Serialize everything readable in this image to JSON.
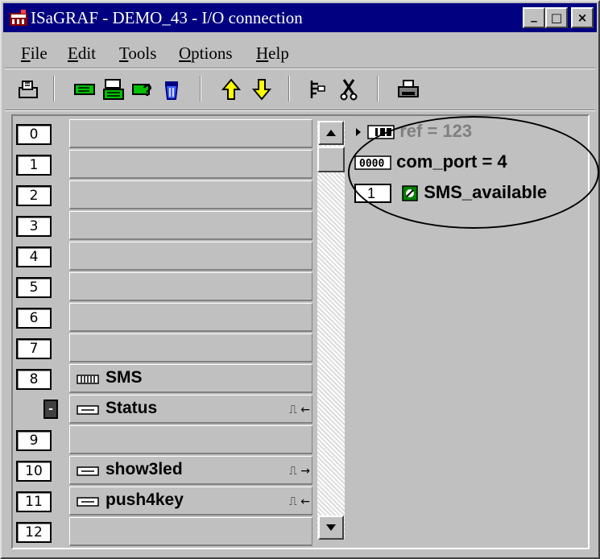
{
  "window": {
    "title": "ISaGRAF - DEMO_43 - I/O connection",
    "controls": {
      "minimize": "_",
      "maximize": "□",
      "close": "×"
    }
  },
  "menu": [
    {
      "label": "File",
      "underline": "F"
    },
    {
      "label": "Edit",
      "underline": "E"
    },
    {
      "label": "Tools",
      "underline": "T"
    },
    {
      "label": "Options",
      "underline": "O"
    },
    {
      "label": "Help",
      "underline": "H"
    }
  ],
  "toolbar": {
    "icons": [
      "open-board-icon",
      "connect-board-icon",
      "board-parameters-icon",
      "virtual-board-icon",
      "delete-board-icon",
      "move-up-icon",
      "move-down-icon",
      "set-parameters-icon",
      "disconnect-icon",
      "print-icon"
    ]
  },
  "slots": [
    {
      "number": "0",
      "label": ""
    },
    {
      "number": "1",
      "label": ""
    },
    {
      "number": "2",
      "label": ""
    },
    {
      "number": "3",
      "label": ""
    },
    {
      "number": "4",
      "label": ""
    },
    {
      "number": "5",
      "label": ""
    },
    {
      "number": "6",
      "label": ""
    },
    {
      "number": "7",
      "label": ""
    },
    {
      "number": "8",
      "label": "SMS",
      "icon": "board-icon"
    },
    {
      "number": "-",
      "label": "Status",
      "icon": "input-board-icon",
      "arrow": "⎍ ←"
    },
    {
      "number": "9",
      "label": ""
    },
    {
      "number": "10",
      "label": "show3led",
      "icon": "output-board-icon",
      "arrow": "⎍ →"
    },
    {
      "number": "11",
      "label": "push4key",
      "icon": "input-board-icon",
      "arrow": "⎍ ←"
    },
    {
      "number": "12",
      "label": ""
    }
  ],
  "variables": {
    "ref": "ref = 123",
    "com_port": "com_port = 4",
    "channel": "1",
    "sms_available": "SMS_available"
  }
}
